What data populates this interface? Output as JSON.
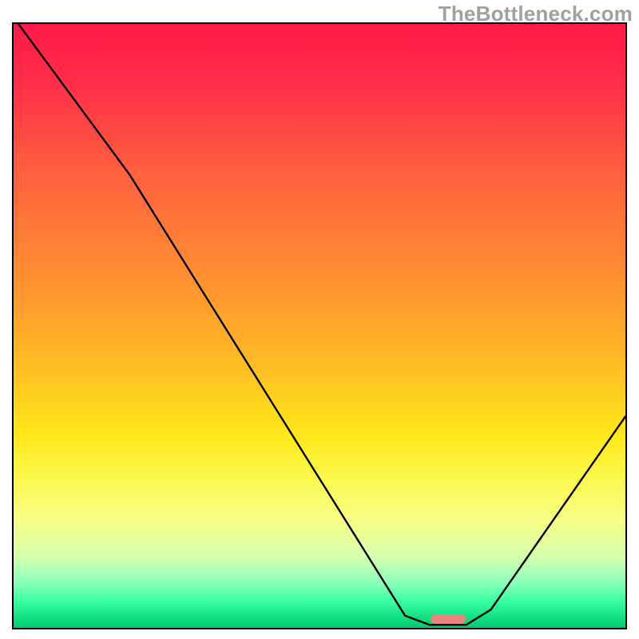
{
  "watermark": "TheBottleneck.com",
  "chart_data": {
    "type": "line",
    "title": "",
    "xlabel": "",
    "ylabel": "",
    "xlim": [
      0,
      100
    ],
    "ylim": [
      0,
      100
    ],
    "grid": false,
    "legend": false,
    "annotations": [],
    "series": [
      {
        "name": "curve",
        "x": [
          0.8,
          19,
          64,
          68,
          74,
          78,
          100
        ],
        "y": [
          100,
          75,
          2,
          0.5,
          0.5,
          3,
          35
        ]
      }
    ],
    "marker": {
      "x_pct": 71,
      "y_pct_from_bottom": 1.5
    },
    "gradient_stops": [
      {
        "pos": 0,
        "color": "#ff1948"
      },
      {
        "pos": 10,
        "color": "#ff2f49"
      },
      {
        "pos": 24,
        "color": "#ff5e3f"
      },
      {
        "pos": 40,
        "color": "#ff8a33"
      },
      {
        "pos": 55,
        "color": "#ffb726"
      },
      {
        "pos": 68,
        "color": "#ffe71a"
      },
      {
        "pos": 75,
        "color": "#fbf84c"
      },
      {
        "pos": 82,
        "color": "#f8fe86"
      },
      {
        "pos": 88,
        "color": "#d8ffac"
      },
      {
        "pos": 92,
        "color": "#95ffbb"
      },
      {
        "pos": 95.5,
        "color": "#3dffa4"
      },
      {
        "pos": 99,
        "color": "#07d77a"
      },
      {
        "pos": 100,
        "color": "#06c96f"
      }
    ],
    "colors": {
      "frame": "#000000",
      "curve": "#000000",
      "marker": "#e9857e",
      "watermark": "#a0a0a0"
    }
  }
}
